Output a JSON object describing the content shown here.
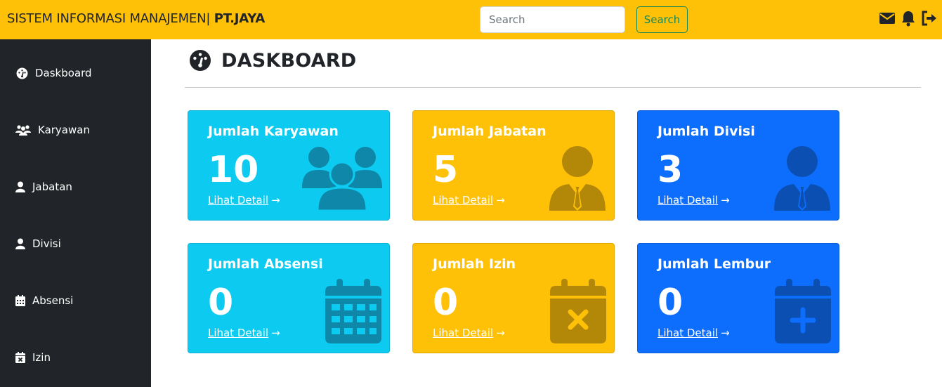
{
  "navbar": {
    "brand_prefix": "SISTEM INFORMASI MANAJEMEN|",
    "brand_company": "PT.JAYA",
    "search_placeholder": "Search",
    "search_button": "Search",
    "icons": [
      "envelope-icon",
      "bell-icon",
      "logout-icon"
    ]
  },
  "sidebar": {
    "items": [
      {
        "label": "Daskboard",
        "icon": "dashboard-icon"
      },
      {
        "label": "Karyawan",
        "icon": "users-icon"
      },
      {
        "label": "Jabatan",
        "icon": "user-icon"
      },
      {
        "label": "Divisi",
        "icon": "user-icon"
      },
      {
        "label": "Absensi",
        "icon": "calendar-icon"
      },
      {
        "label": "Izin",
        "icon": "calendar-x-icon"
      }
    ]
  },
  "main": {
    "title": "DASKBOARD",
    "cards": [
      {
        "title": "Jumlah Karyawan",
        "value": "10",
        "link": "Lihat Detail",
        "icon": "users-icon",
        "color": "#0dcaf0"
      },
      {
        "title": "Jumlah Jabatan",
        "value": "5",
        "link": "Lihat Detail",
        "icon": "user-tie-icon",
        "color": "#ffc107"
      },
      {
        "title": "Jumlah Divisi",
        "value": "3",
        "link": "Lihat Detail",
        "icon": "user-tie-icon",
        "color": "#0d6efd"
      },
      {
        "title": "Jumlah Absensi",
        "value": "0",
        "link": "Lihat Detail",
        "icon": "calendar-icon",
        "color": "#0dcaf0"
      },
      {
        "title": "Jumlah Izin",
        "value": "0",
        "link": "Lihat Detail",
        "icon": "calendar-x-icon",
        "color": "#ffc107"
      },
      {
        "title": "Jumlah Lembur",
        "value": "0",
        "link": "Lihat Detail",
        "icon": "calendar-plus-icon",
        "color": "#0d6efd"
      }
    ]
  }
}
